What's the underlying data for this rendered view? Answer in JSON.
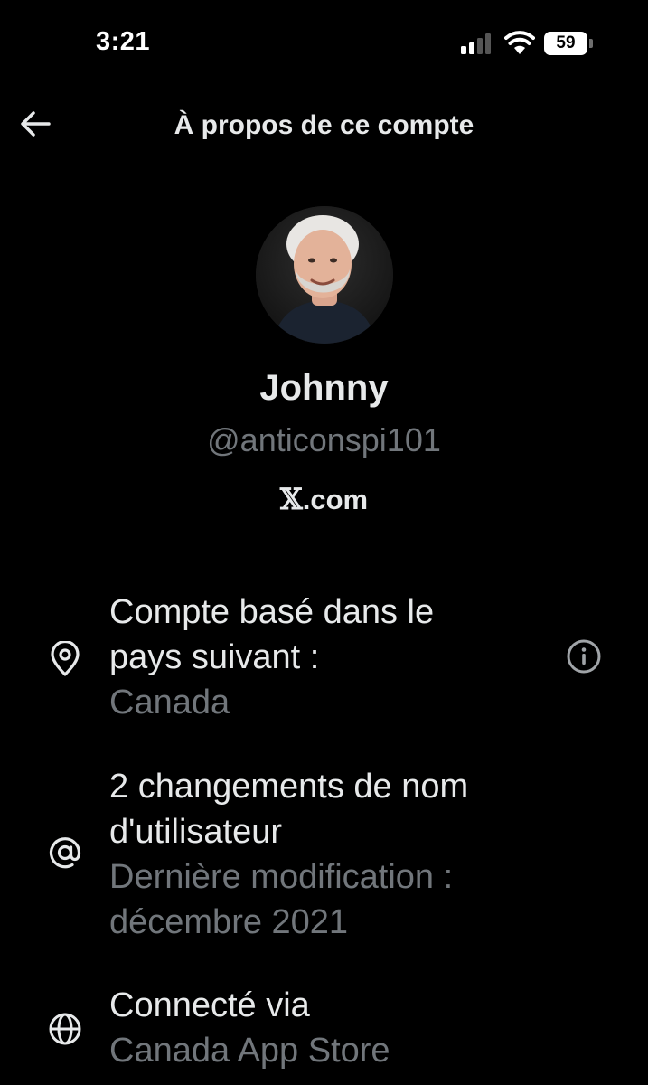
{
  "status_bar": {
    "time": "3:21",
    "battery": "59",
    "icons": [
      "signal-icon",
      "wifi-icon",
      "battery-icon"
    ]
  },
  "header": {
    "title": "À propos de ce compte",
    "back_icon": "arrow-left-icon"
  },
  "profile": {
    "avatar": "avatar-photo",
    "name": "Johnny",
    "handle": "@anticonspi101",
    "site_logo": "𝕏",
    "site_suffix": ".com"
  },
  "rows": [
    {
      "icon": "location-pin-icon",
      "title_line1": "Compte basé dans le",
      "title_line2": "pays suivant :",
      "value": "Canada",
      "action_icon": "info-icon"
    },
    {
      "icon": "at-sign-icon",
      "title_line1": "2 changements de nom",
      "title_line2": "d'utilisateur",
      "sub_line1": "Dernière modification :",
      "sub_line2": "décembre 2021"
    },
    {
      "icon": "globe-icon",
      "title_line1": "Connecté via",
      "value": "Canada App Store"
    }
  ],
  "colors": {
    "background": "#000000",
    "primary_text": "#e7e9ea",
    "secondary_text": "#71767b"
  }
}
